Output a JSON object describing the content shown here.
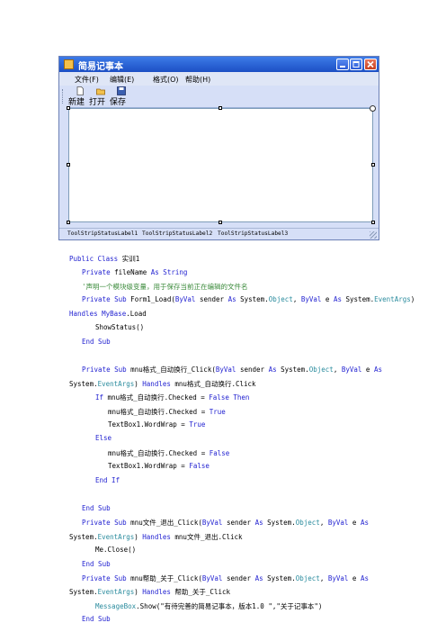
{
  "window": {
    "title": "简易记事本",
    "menus": [
      "文件(F)",
      "编辑(E)",
      "格式(O)",
      "帮助(H)"
    ],
    "toolbar": [
      "新建",
      "打开",
      "保存"
    ],
    "status_labels": [
      "ToolStripStatusLabel1",
      "ToolStripStatusLabel2",
      "ToolStripStatusLabel3"
    ]
  },
  "code": {
    "line1": [
      "Public Class",
      " 实训1"
    ],
    "line2": [
      "Private",
      " fileName ",
      "As String"
    ],
    "line3": "'声明一个模块级变量，用于保存当前正在编辑的文件名",
    "line4": [
      "Private Sub",
      " Form1_Load(",
      "ByVal",
      " sender ",
      "As",
      " System.",
      "Object",
      ", ",
      "ByVal",
      " e ",
      "As",
      " System.",
      "EventArgs",
      ")"
    ],
    "line5": [
      "Handles",
      " ",
      "MyBase",
      ".Load"
    ],
    "line6": "ShowStatus()",
    "line7": "End Sub",
    "line8": [
      "Private Sub",
      " mnu格式_自动换行_Click(",
      "ByVal",
      " sender ",
      "As",
      " System.",
      "Object",
      ", ",
      "ByVal",
      " e ",
      "As"
    ],
    "line9": [
      "System.",
      "EventArgs",
      ") ",
      "Handles",
      " mnu格式_自动换行.Click"
    ],
    "line10": [
      "If",
      " mnu格式_自动换行.Checked = ",
      "False Then"
    ],
    "line11": [
      "mnu格式_自动换行.Checked = ",
      "True"
    ],
    "line12": [
      "TextBox1.WordWrap = ",
      "True"
    ],
    "line13": "Else",
    "line14": [
      "mnu格式_自动换行.Checked = ",
      "False"
    ],
    "line15": [
      "TextBox1.WordWrap = ",
      "False"
    ],
    "line16": "End If",
    "line17": "End Sub",
    "line18": [
      "Private Sub",
      " mnu文件_退出_Click(",
      "ByVal",
      " sender ",
      "As",
      " System.",
      "Object",
      ", ",
      "ByVal",
      " e ",
      "As"
    ],
    "line19": [
      "System.",
      "EventArgs",
      ") ",
      "Handles",
      " mnu文件_退出.Click"
    ],
    "line20": "Me.Close()",
    "line21": "End Sub",
    "line22": [
      "Private Sub",
      " mnu帮助_关于_Click(",
      "ByVal",
      " sender ",
      "As",
      " System.",
      "Object",
      ", ",
      "ByVal",
      " e ",
      "As"
    ],
    "line23": [
      "System.",
      "EventArgs",
      ") ",
      "Handles",
      " 帮助_关于_Click"
    ],
    "line24": [
      "MessageBox",
      ".Show(\"有待完善的简易记事本，版本1.0 \",\"关于记事本\")"
    ],
    "line25": "End Sub"
  }
}
